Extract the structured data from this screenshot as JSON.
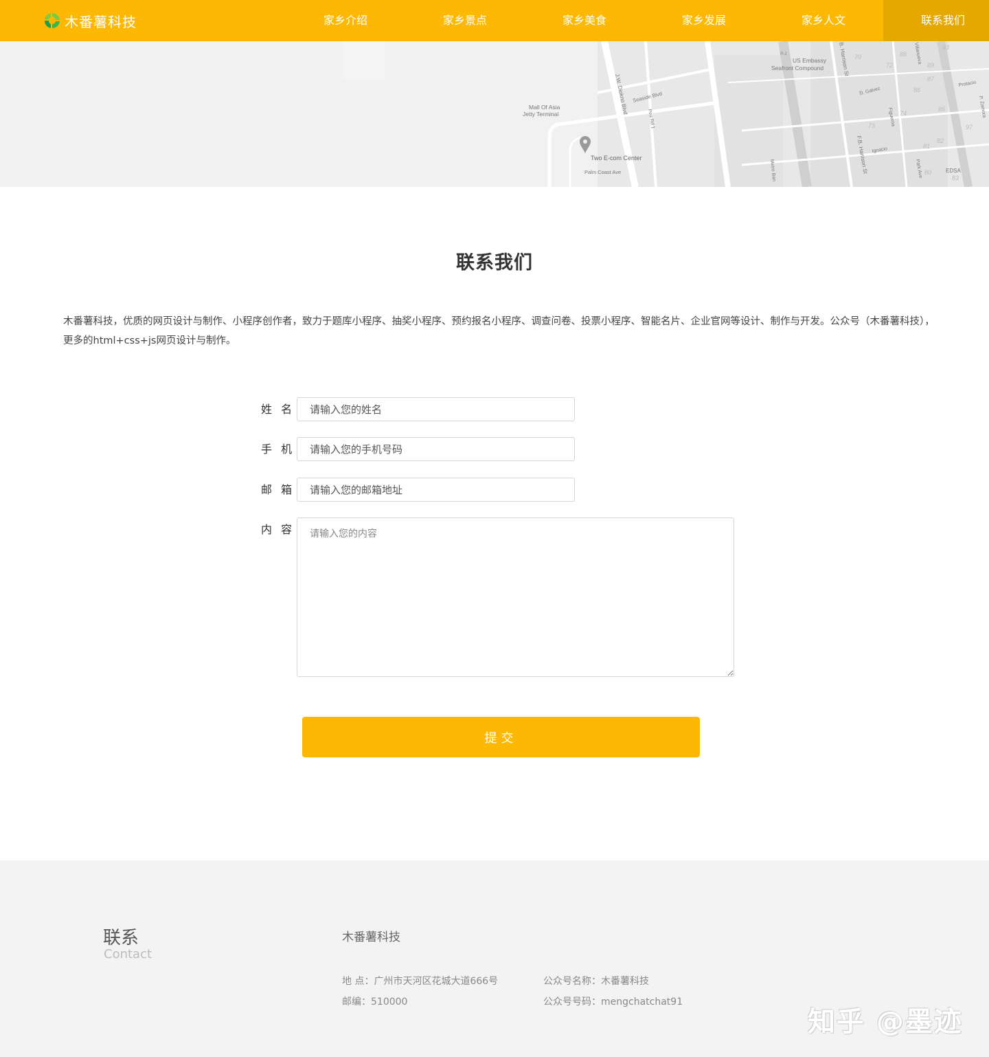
{
  "nav": {
    "brand": "木番薯科技",
    "items": [
      {
        "label": "家乡介绍"
      },
      {
        "label": "家乡景点"
      },
      {
        "label": "家乡美食"
      },
      {
        "label": "家乡发展"
      },
      {
        "label": "家乡人文"
      },
      {
        "label": "联系我们"
      }
    ],
    "active_index": 5
  },
  "map": {
    "labels": {
      "embassy": "US Embassy",
      "embassy2": "Seafront Compound",
      "mall": "Mall Of Asia",
      "mall2": "Jetty Terminal",
      "ecom": "Two E-com Center",
      "palm": "Palm Coast Ave",
      "seaside": "Seaside Blvd",
      "diokno": "J.W. Diokno Blvd",
      "pearl": "Pea Rd 1",
      "harrison": "B. Harrison St",
      "fb_harrison": "F.B. Harrison St",
      "galvez": "D. Galvez",
      "figueroa": "Figueroa",
      "ignacio": "Ignacio",
      "metro": "Metro Ban",
      "park": "Park Ave",
      "edsa": "EDSA",
      "protacio": "Protacio",
      "zamora": "P. Zamora",
      "villanueva": "Villanueva",
      "r1": "R-1",
      "n70": "70",
      "n72": "72",
      "n73": "73",
      "n74": "74",
      "n80": "80",
      "n81": "81",
      "n82": "82",
      "n83": "83",
      "n85": "85",
      "n86": "86",
      "n87": "87",
      "n88": "88",
      "n89": "89",
      "n93": "93",
      "n97": "97"
    }
  },
  "section": {
    "title": "联系我们",
    "intro": "木番薯科技，优质的网页设计与制作、小程序创作者，致力于题库小程序、抽奖小程序、预约报名小程序、调查问卷、投票小程序、智能名片、企业官网等设计、制作与开发。公众号（木番薯科技），更多的html+css+js网页设计与制作。"
  },
  "form": {
    "name_label": "姓 名",
    "name_placeholder": "请输入您的姓名",
    "phone_label": "手 机",
    "phone_placeholder": "请输入您的手机号码",
    "email_label": "邮 箱",
    "email_placeholder": "请输入您的邮箱地址",
    "content_label": "内 容",
    "content_placeholder": "请输入您的内容",
    "submit_label": "提交"
  },
  "footer": {
    "title_cn": "联系",
    "title_en": "Contact",
    "company": "木番薯科技",
    "address": "地 点：广州市天河区花城大道666号",
    "postcode": "邮编：510000",
    "account_name": "公众号名称：木番薯科技",
    "account_id": "公众号号码：mengchatchat91",
    "watermark": "知乎 @墨迹"
  },
  "colors": {
    "brand": "#FDB803",
    "nav_active": "#E5A800",
    "footer_bg": "#f3f3f3"
  }
}
